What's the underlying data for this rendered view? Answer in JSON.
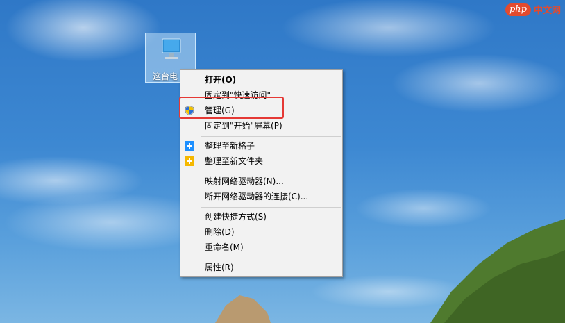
{
  "watermark": {
    "logo": "php",
    "text": "中文网"
  },
  "desktop": {
    "icon_label": "这台电"
  },
  "menu": {
    "items": [
      {
        "label": "打开(O)"
      },
      {
        "label": "固定到\"快速访问\""
      },
      {
        "label": "管理(G)",
        "icon": "uac-shield-icon"
      },
      {
        "label": "固定到\"开始\"屏幕(P)"
      },
      {
        "label": "整理至新格子",
        "icon": "plus-icon"
      },
      {
        "label": "整理至新文件夹",
        "icon": "folder-plus-icon"
      },
      {
        "label": "映射网络驱动器(N)..."
      },
      {
        "label": "断开网络驱动器的连接(C)..."
      },
      {
        "label": "创建快捷方式(S)"
      },
      {
        "label": "删除(D)"
      },
      {
        "label": "重命名(M)"
      },
      {
        "label": "属性(R)"
      }
    ]
  },
  "colors": {
    "highlight": "#e53935",
    "menu_bg": "#f2f2f2",
    "accent_blue": "#1e90ff",
    "accent_yellow": "#f5b800"
  }
}
